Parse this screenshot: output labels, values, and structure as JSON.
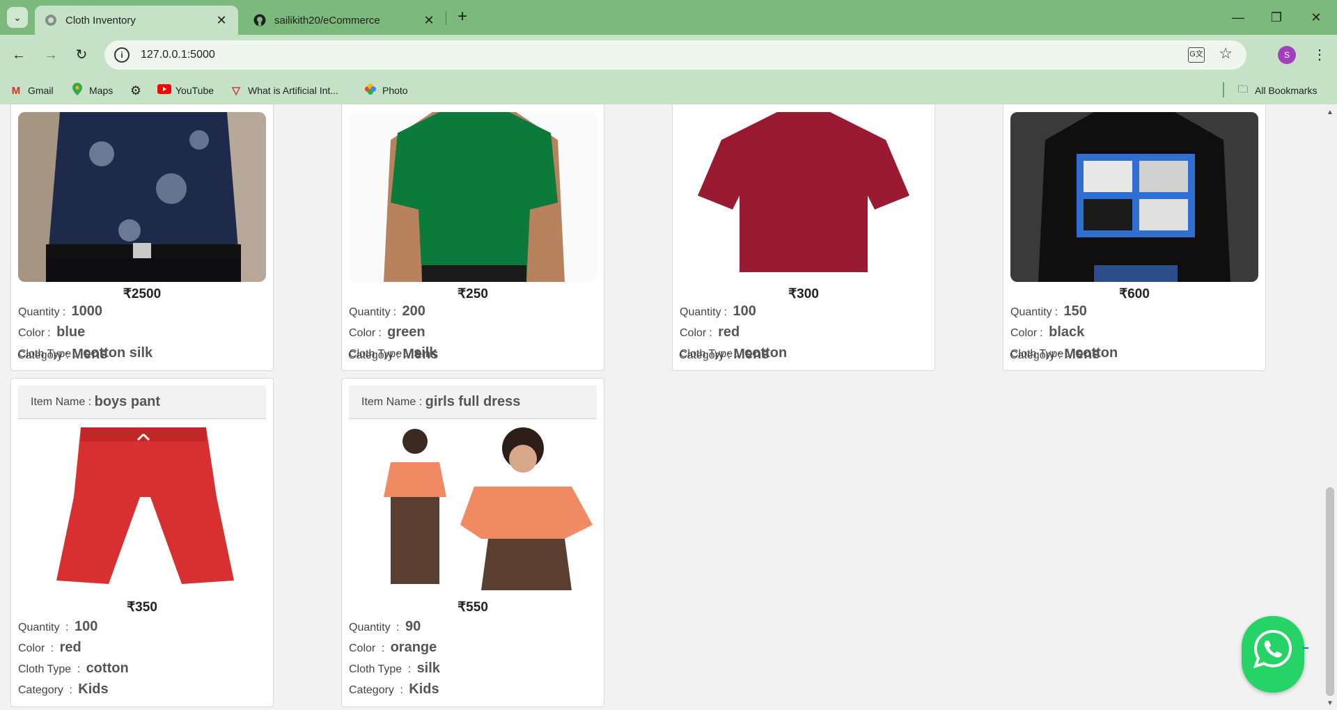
{
  "browser": {
    "tabs": [
      {
        "title": "Cloth Inventory",
        "active": true,
        "icon": "globe-icon"
      },
      {
        "title": "sailikith20/eCommerce",
        "active": false,
        "icon": "github-icon"
      }
    ],
    "address": "127.0.0.1:5000",
    "profile_initial": "S",
    "bookmarks": [
      {
        "label": "Gmail",
        "icon": "gmail-icon"
      },
      {
        "label": "Maps",
        "icon": "maps-icon"
      },
      {
        "label": "",
        "icon": "settings-gear-icon"
      },
      {
        "label": "YouTube",
        "icon": "youtube-icon"
      },
      {
        "label": "What is Artificial Int...",
        "icon": "v-logo-icon"
      },
      {
        "label": "Photo",
        "icon": "google-photos-icon"
      }
    ],
    "all_bookmarks": "All Bookmarks"
  },
  "labels": {
    "item_name": "Item Name",
    "quantity": "Quantity",
    "color": "Color",
    "cloth_type": "Cloth Type",
    "category": "Category",
    "sep": ":"
  },
  "products": [
    {
      "name": "",
      "price": "₹2500",
      "quantity": "1000",
      "color": "blue",
      "cloth_type": "cotton silk",
      "category": "Mens",
      "image": "navy floral print shirt"
    },
    {
      "name": "",
      "price": "₹250",
      "quantity": "200",
      "color": "green",
      "cloth_type": "silk",
      "category": "Mens",
      "image": "green t-shirt"
    },
    {
      "name": "",
      "price": "₹300",
      "quantity": "100",
      "color": "red",
      "cloth_type": "cotton",
      "category": "Mens",
      "image": "maroon t-shirt"
    },
    {
      "name": "",
      "price": "₹600",
      "quantity": "150",
      "color": "black",
      "cloth_type": "cotton",
      "category": "Mens",
      "image": "black roadster graphic t-shirt"
    },
    {
      "name": "boys pant",
      "price": "₹350",
      "quantity": "100",
      "color": "red",
      "cloth_type": "cotton",
      "category": "Kids",
      "image": "red jogger pants"
    },
    {
      "name": "girls full dress",
      "price": "₹550",
      "quantity": "90",
      "color": "orange",
      "cloth_type": "silk",
      "category": "Kids",
      "image": "girl in orange top and striped palazzo"
    }
  ],
  "colors": {
    "tabbar": "#7cb97c",
    "toolbar": "#c6e2c6",
    "whatsapp": "#25d366"
  }
}
